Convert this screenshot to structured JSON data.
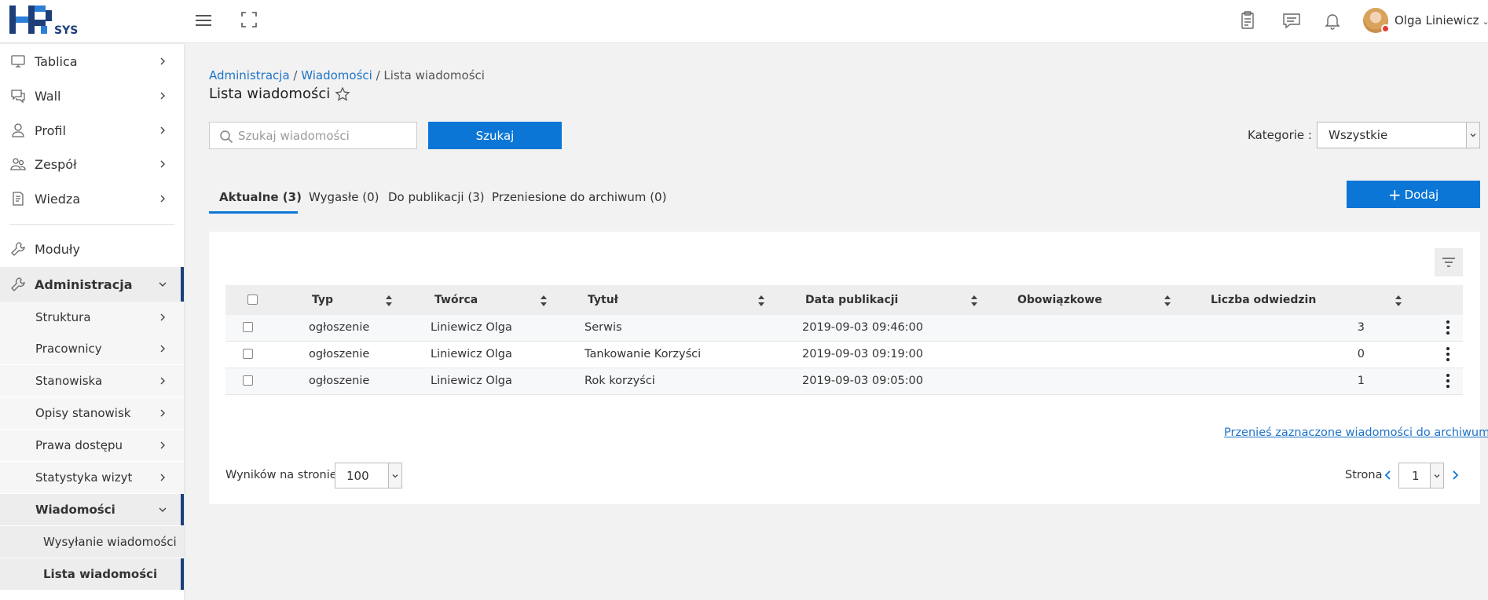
{
  "header": {
    "logo_text": "SYS",
    "user_name": "Olga Liniewicz"
  },
  "sidebar": {
    "items": [
      {
        "label": "Tablica"
      },
      {
        "label": "Wall"
      },
      {
        "label": "Profil"
      },
      {
        "label": "Zespół"
      },
      {
        "label": "Wiedza"
      },
      {
        "label": "Moduły"
      },
      {
        "label": "Administracja"
      }
    ],
    "admin_sub": [
      {
        "label": "Struktura"
      },
      {
        "label": "Pracownicy"
      },
      {
        "label": "Stanowiska"
      },
      {
        "label": "Opisy stanowisk"
      },
      {
        "label": "Prawa dostępu"
      },
      {
        "label": "Statystyka wizyt"
      },
      {
        "label": "Wiadomości"
      }
    ],
    "wiadomosci_sub": [
      {
        "label": "Wysyłanie wiadomości"
      },
      {
        "label": "Lista wiadomości"
      }
    ],
    "accent_color": "#1c3f7a"
  },
  "breadcrumb": {
    "part1": "Administracja",
    "sep1": " / ",
    "part2": "Wiadomości",
    "sep2": " / ",
    "part3": "Lista wiadomości"
  },
  "page_title": "Lista wiadomości",
  "search": {
    "placeholder": "Szukaj wiadomości",
    "value": "",
    "button_label": "Szukaj"
  },
  "category": {
    "label": "Kategorie :",
    "selected": "Wszystkie"
  },
  "tabs": [
    {
      "label": "Aktualne (3)"
    },
    {
      "label": "Wygasłe (0)"
    },
    {
      "label": "Do publikacji (3)"
    },
    {
      "label": "Przeniesione do archiwum (0)"
    }
  ],
  "add_button": {
    "label": "Dodaj"
  },
  "table": {
    "columns": [
      "Typ",
      "Twórca",
      "Tytuł",
      "Data publikacji",
      "Obowiązkowe",
      "Liczba odwiedzin"
    ],
    "rows": [
      {
        "typ": "ogłoszenie",
        "tworca": "Liniewicz Olga",
        "tytul": "Serwis",
        "data": "2019-09-03 09:46:00",
        "obowiazkowe": "",
        "odwiedziny": "3"
      },
      {
        "typ": "ogłoszenie",
        "tworca": "Liniewicz Olga",
        "tytul": "Tankowanie Korzyści",
        "data": "2019-09-03 09:19:00",
        "obowiazkowe": "",
        "odwiedziny": "0"
      },
      {
        "typ": "ogłoszenie",
        "tworca": "Liniewicz Olga",
        "tytul": "Rok korzyści",
        "data": "2019-09-03 09:05:00",
        "obowiazkowe": "",
        "odwiedziny": "1"
      }
    ]
  },
  "archive_link": "Przenieś zaznaczone wiadomości do archiwum",
  "pagination": {
    "per_page_label": "Wyników na stronie:",
    "per_page_value": "100",
    "page_label": "Strona",
    "page_value": "1"
  },
  "colors": {
    "primary": "#0b76d6",
    "link": "#1e73c8"
  }
}
